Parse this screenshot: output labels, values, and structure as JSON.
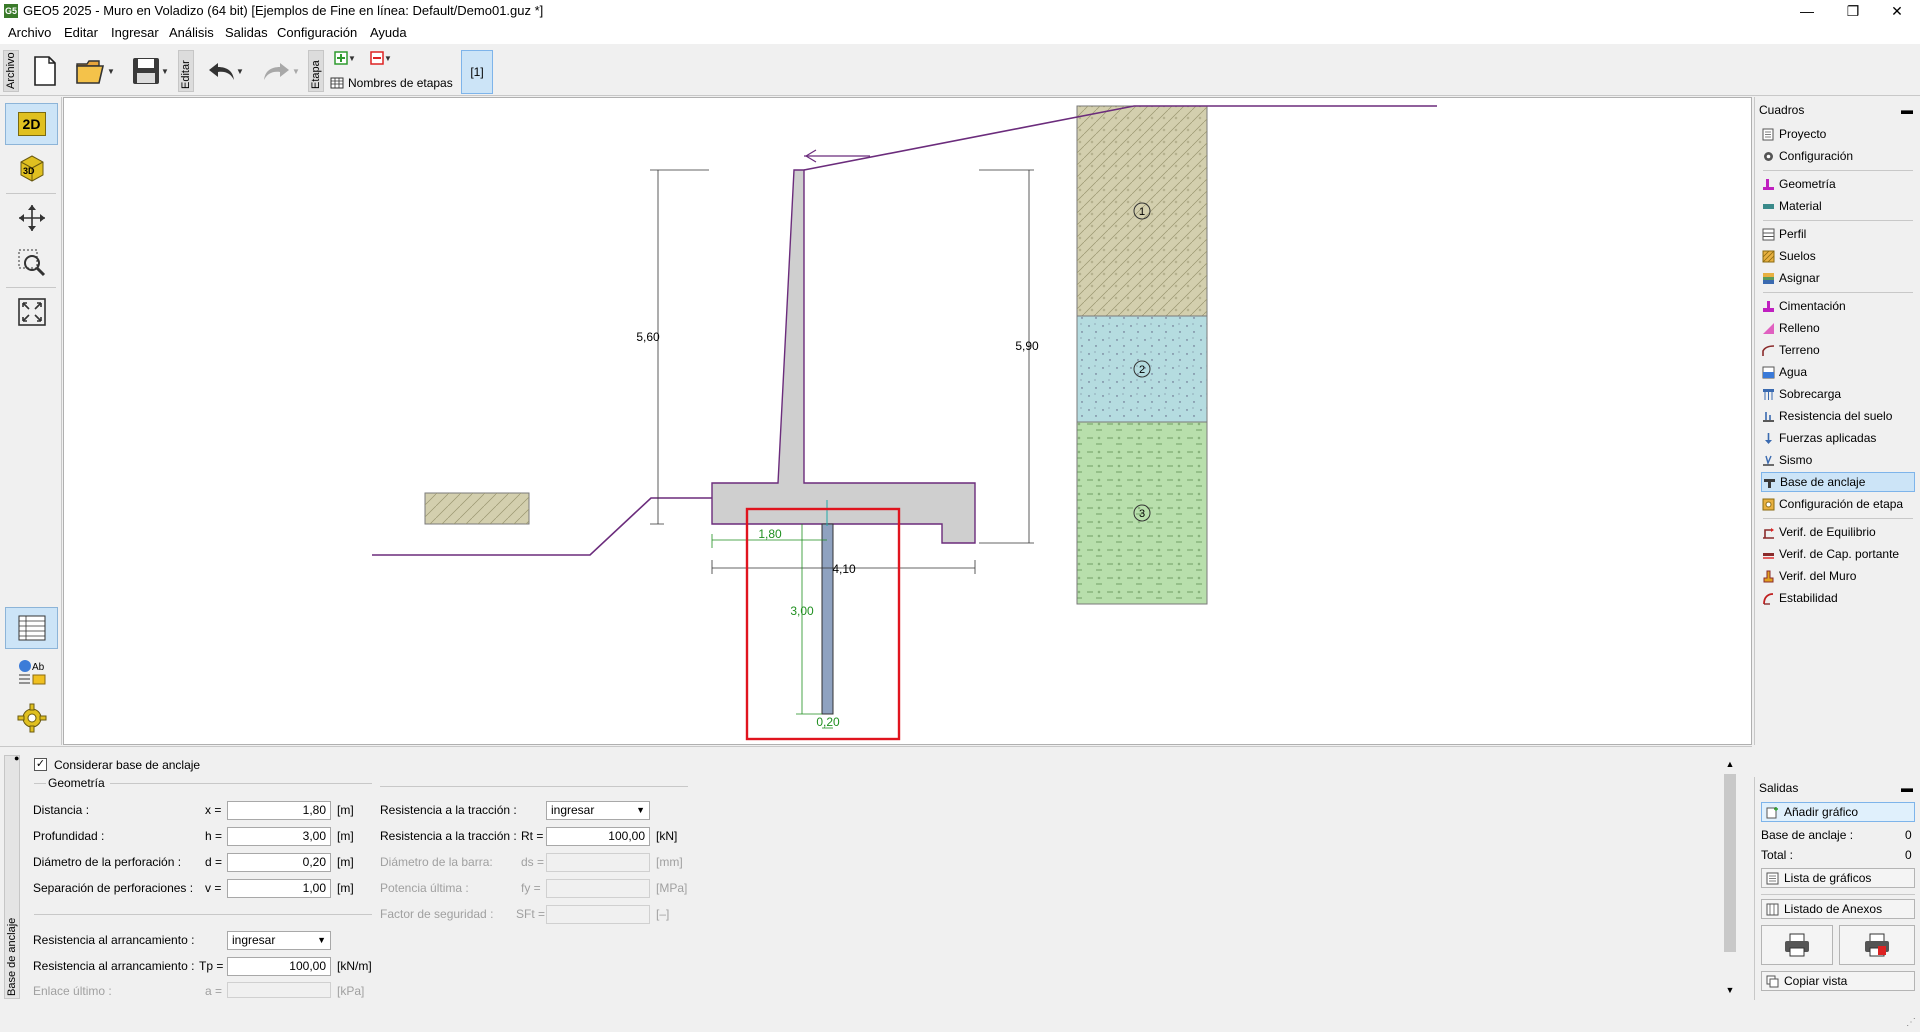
{
  "window": {
    "title": "GEO5 2025 - Muro en Voladizo (64 bit) [Ejemplos de Fine en línea: Default/Demo01.guz *]",
    "app_icon_text": "G5"
  },
  "menu": [
    "Archivo",
    "Editar",
    "Ingresar",
    "Análisis",
    "Salidas",
    "Configuración",
    "Ayuda"
  ],
  "toolbar": {
    "archivo_label": "Archivo",
    "editar_label": "Editar",
    "etapa_label": "Etapa",
    "stage_names_label": "Nombres de etapas",
    "stage_button": "[1]"
  },
  "left_tools": {
    "view_2d": "2D",
    "view_3d": "3D"
  },
  "drawing": {
    "dim_wall_height": "5,60",
    "dim_backfill_height": "5,90",
    "dim_distance": "1,80",
    "dim_base_width": "4,10",
    "dim_pile_depth": "3,00",
    "dim_pile_diameter": "0,20",
    "soil_1": "1",
    "soil_2": "2",
    "soil_3": "3",
    "colors": {
      "concrete": "#cfcfcf",
      "terrain_line": "#6b2c7c",
      "soil_1": "#d3cfae",
      "soil_2": "#b5dce0",
      "soil_3": "#b8dfac",
      "highlight": "#e0141e",
      "dimension_green": "#1f8f1f",
      "pile": "#8fa2c0"
    }
  },
  "cuadros": {
    "title": "Cuadros",
    "items": [
      {
        "label": "Proyecto",
        "icon": "document-icon"
      },
      {
        "label": "Configuración",
        "icon": "gear-icon"
      },
      {
        "label": "Geometría",
        "icon": "geometry-icon"
      },
      {
        "label": "Material",
        "icon": "material-icon"
      },
      {
        "label": "Perfil",
        "icon": "profile-icon"
      },
      {
        "label": "Suelos",
        "icon": "soils-icon"
      },
      {
        "label": "Asignar",
        "icon": "assign-icon"
      },
      {
        "label": "Cimentación",
        "icon": "foundation-icon"
      },
      {
        "label": "Relleno",
        "icon": "backfill-icon"
      },
      {
        "label": "Terreno",
        "icon": "terrain-icon"
      },
      {
        "label": "Agua",
        "icon": "water-icon"
      },
      {
        "label": "Sobrecarga",
        "icon": "surcharge-icon"
      },
      {
        "label": "Resistencia del suelo",
        "icon": "soil-resistance-icon"
      },
      {
        "label": "Fuerzas aplicadas",
        "icon": "forces-icon"
      },
      {
        "label": "Sismo",
        "icon": "earthquake-icon"
      },
      {
        "label": "Base de anclaje",
        "icon": "anchor-base-icon"
      },
      {
        "label": "Configuración de etapa",
        "icon": "stage-settings-icon"
      },
      {
        "label": "Verif. de Equilibrio",
        "icon": "equilibrium-icon"
      },
      {
        "label": "Verif. de Cap. portante",
        "icon": "bearing-icon"
      },
      {
        "label": "Verif. del Muro",
        "icon": "wall-check-icon"
      },
      {
        "label": "Estabilidad",
        "icon": "stability-icon"
      }
    ]
  },
  "form": {
    "tab_label": "Base de anclaje",
    "consider_label": "Considerar base de anclaje",
    "geometry_title": "Geometría",
    "distance": {
      "label": "Distancia :",
      "sym": "x =",
      "value": "1,80",
      "unit": "[m]"
    },
    "depth": {
      "label": "Profundidad :",
      "sym": "h =",
      "value": "3,00",
      "unit": "[m]"
    },
    "diameter": {
      "label": "Diámetro de la perforación :",
      "sym": "d =",
      "value": "0,20",
      "unit": "[m]"
    },
    "spacing": {
      "label": "Separación de perforaciones :",
      "sym": "v =",
      "value": "1,00",
      "unit": "[m]"
    },
    "tensile_mode": {
      "label": "Resistencia a la tracción :",
      "value": "ingresar"
    },
    "tensile": {
      "label": "Resistencia a la tracción :",
      "sym": "Rt =",
      "value": "100,00",
      "unit": "[kN]"
    },
    "bar_diameter": {
      "label": "Diámetro de la barra:",
      "sym": "ds =",
      "value": "",
      "unit": "[mm]"
    },
    "ultimate_strength": {
      "label": "Potencia última :",
      "sym": "fy =",
      "value": "",
      "unit": "[MPa]"
    },
    "safety_factor": {
      "label": "Factor de seguridad :",
      "sym": "SFt =",
      "value": "",
      "unit": "[–]"
    },
    "pullout_mode": {
      "label": "Resistencia al arrancamiento :",
      "value": "ingresar"
    },
    "pullout": {
      "label": "Resistencia al arrancamiento :",
      "sym": "Tp =",
      "value": "100,00",
      "unit": "[kN/m]"
    },
    "bond": {
      "label": "Enlace último :",
      "sym": "a =",
      "value": "",
      "unit": "[kPa]"
    }
  },
  "outputs": {
    "title": "Salidas",
    "add_graphic": "Añadir gráfico",
    "base_label": "Base de anclaje :",
    "base_count": "0",
    "total_label": "Total :",
    "total_count": "0",
    "graphics_list": "Lista de gráficos",
    "annex_list": "Listado de Anexos",
    "copy_view": "Copiar vista"
  }
}
